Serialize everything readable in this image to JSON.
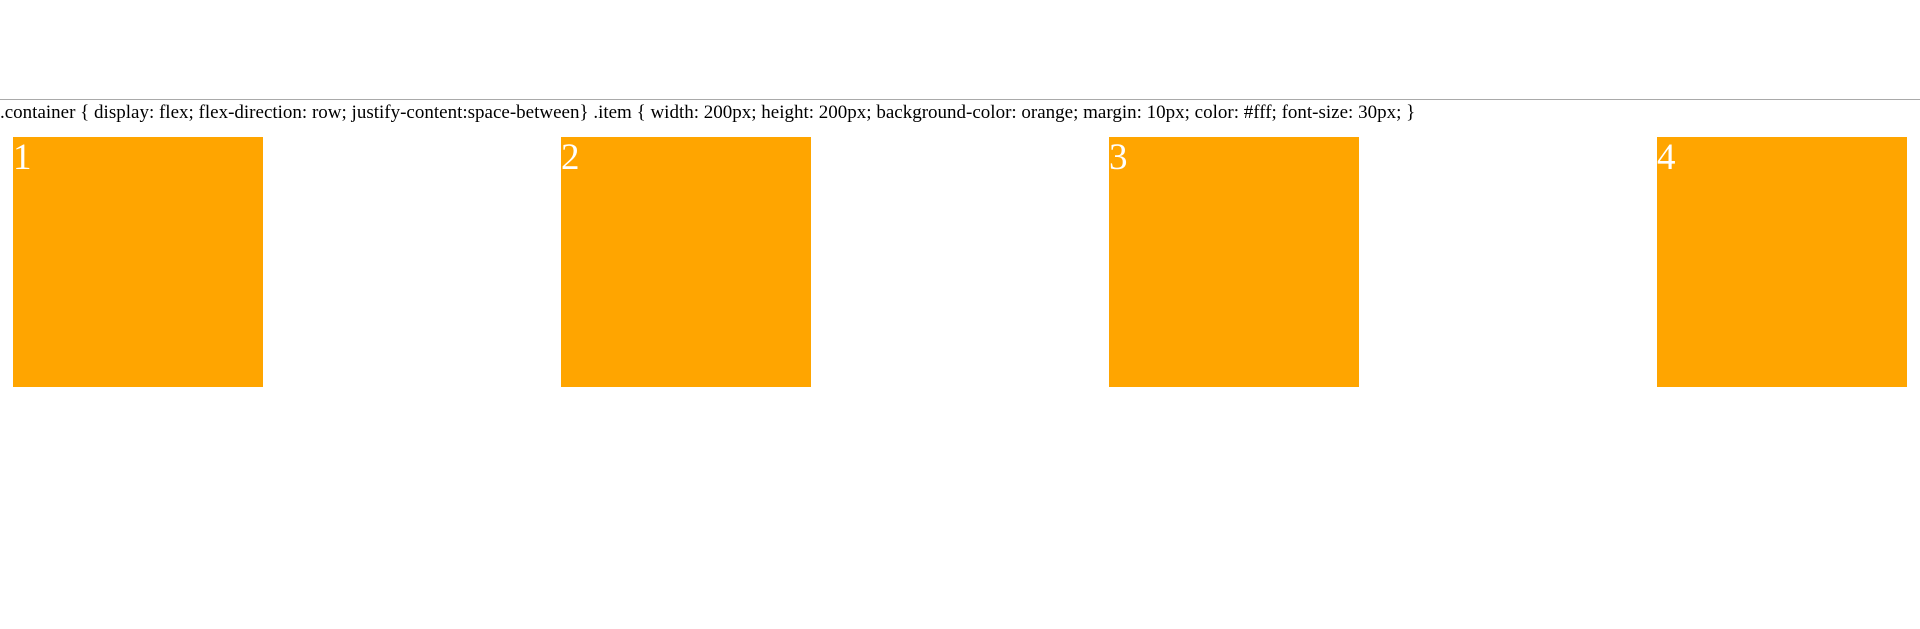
{
  "css_code_text": ".container { display: flex; flex-direction: row; justify-content:space-between} .item { width: 200px; height: 200px; background-color: orange; margin: 10px; color: #fff; font-size: 30px; }",
  "items": [
    {
      "label": "1"
    },
    {
      "label": "2"
    },
    {
      "label": "3"
    },
    {
      "label": "4"
    }
  ],
  "colors": {
    "item_background": "#ffa500",
    "item_text": "#ffffff",
    "page_background": "#ffffff",
    "divider": "#a9a9a9"
  }
}
